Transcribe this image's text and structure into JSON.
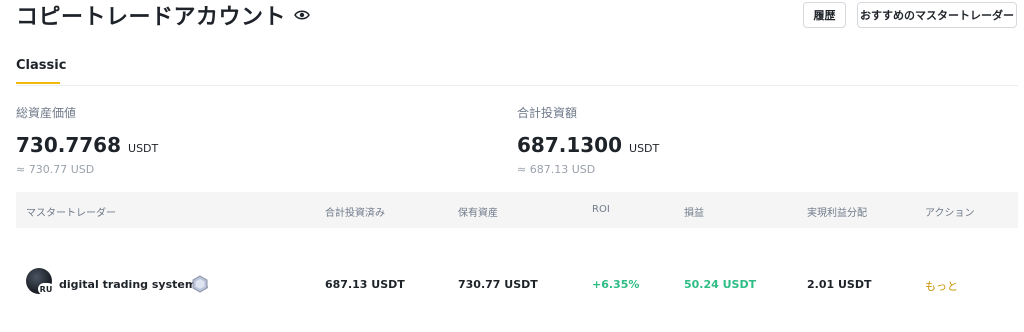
{
  "header": {
    "title": "コピートレードアカウント",
    "history_label": "履歴",
    "recommend_label": "おすすめのマスタートレーダー"
  },
  "tabs": [
    {
      "label": "Classic",
      "active": true
    }
  ],
  "summary": {
    "total_assets": {
      "label": "総資産価値",
      "value": "730.7768",
      "unit": "USDT",
      "approx": "≈ 730.77 USD"
    },
    "total_invested": {
      "label": "合計投資額",
      "value": "687.1300",
      "unit": "USDT",
      "approx": "≈ 687.13 USD"
    }
  },
  "table": {
    "columns": [
      "マスタートレーダー",
      "合計投資済み",
      "保有資産",
      "ROI",
      "損益",
      "実現利益分配",
      "アクション"
    ],
    "rows": [
      {
        "trader": "digital trading system...",
        "avatar_badge": "RU",
        "invested": "687.13 USDT",
        "holdings": "730.77 USDT",
        "roi": "+6.35%",
        "pnl": "50.24 USDT",
        "realized_share": "2.01 USDT",
        "action": "もっと"
      }
    ]
  },
  "colors": {
    "accent": "#f0b90b",
    "positive": "#2ebd85",
    "action": "#c99400",
    "text": "#1e2329",
    "muted": "#707a8a"
  }
}
